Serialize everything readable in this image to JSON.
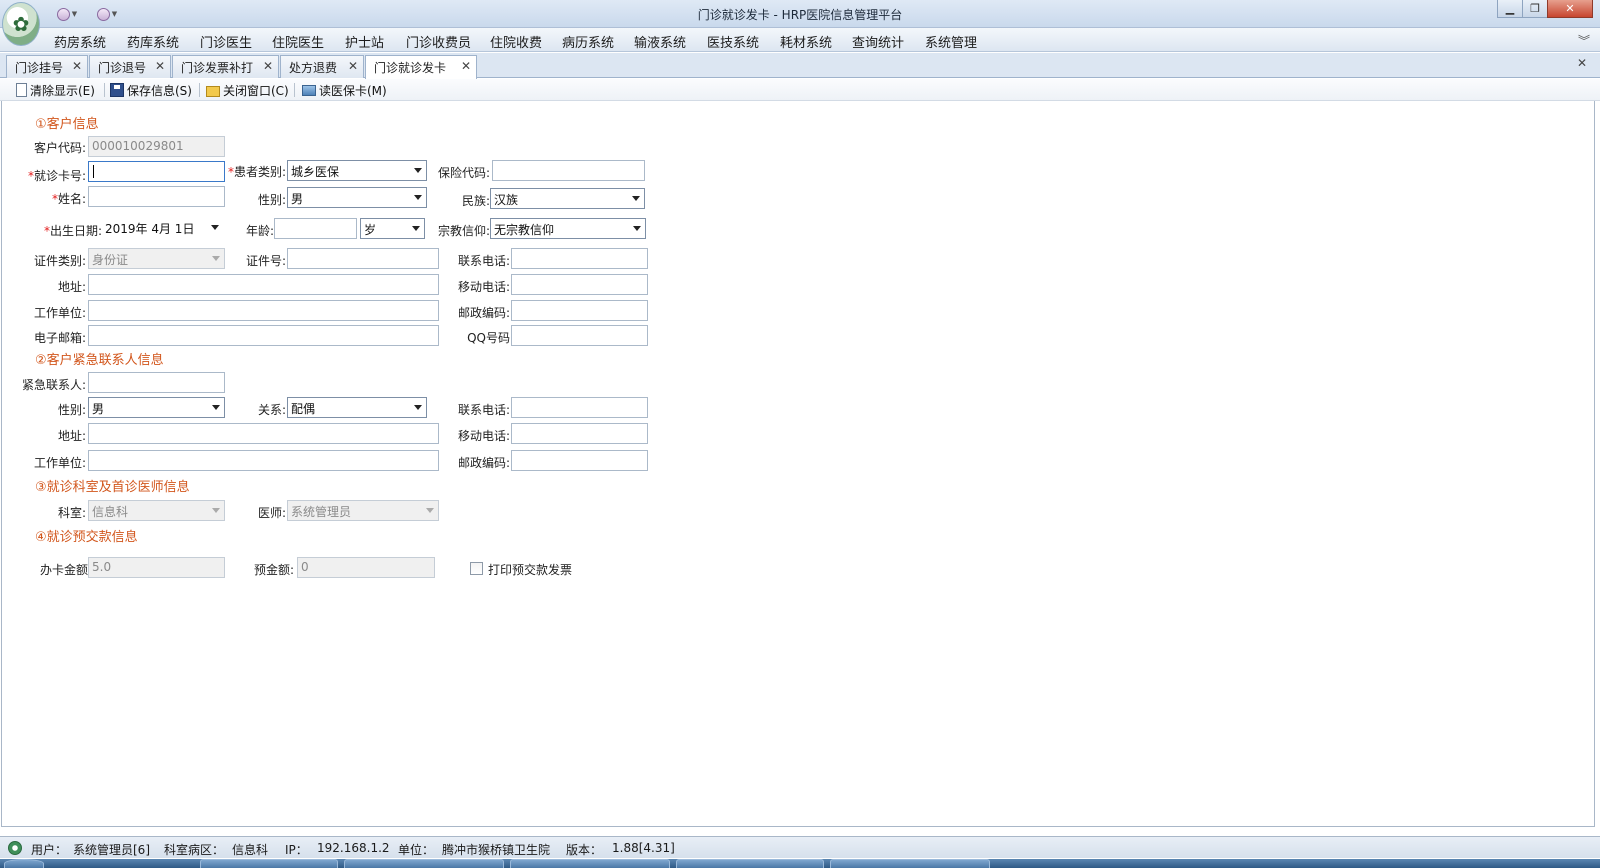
{
  "window": {
    "title": "门诊就诊发卡 - HRP医院信息管理平台",
    "min_glyph": "▁",
    "max_glyph": "❐",
    "close_glyph": "✕"
  },
  "menu": {
    "items": [
      "药房系统",
      "药库系统",
      "门诊医生",
      "住院医生",
      "护士站",
      "门诊收费员",
      "住院收费",
      "病历系统",
      "输液系统",
      "医技系统",
      "耗材系统",
      "查询统计",
      "系统管理"
    ],
    "collapse_glyph": "︾"
  },
  "tabs": {
    "items": [
      {
        "label": "门诊挂号"
      },
      {
        "label": "门诊退号"
      },
      {
        "label": "门诊发票补打"
      },
      {
        "label": "处方退费"
      },
      {
        "label": "门诊就诊发卡"
      }
    ],
    "active_index": 4,
    "close_glyph": "✕"
  },
  "toolbar": {
    "clear_label": "清除显示(E)",
    "save_label": "保存信息(S)",
    "close_label": "关闭窗口(C)",
    "read_card_label": "读医保卡(M)"
  },
  "form": {
    "section1_title": "①客户信息",
    "customer_code_label": "客户代码:",
    "customer_code_value": "000010029801",
    "card_no_label": "就诊卡号:",
    "card_no_value": "",
    "patient_type_label": "患者类别:",
    "patient_type_value": "城乡医保",
    "insurance_code_label": "保险代码:",
    "insurance_code_value": "",
    "name_label": "姓名:",
    "name_value": "",
    "gender_label": "性别:",
    "gender_value": "男",
    "ethnicity_label": "民族:",
    "ethnicity_value": "汉族",
    "birth_label": "出生日期:",
    "birth_value": "2019年  4月  1日",
    "age_label": "年龄:",
    "age_value": "",
    "age_unit_value": "岁",
    "religion_label": "宗教信仰:",
    "religion_value": "无宗教信仰",
    "id_type_label": "证件类别:",
    "id_type_value": "身份证",
    "id_no_label": "证件号:",
    "id_no_value": "",
    "phone_label": "联系电话:",
    "phone_value": "",
    "address_label": "地址:",
    "address_value": "",
    "mobile_label": "移动电话:",
    "mobile_value": "",
    "work_label": "工作单位:",
    "work_value": "",
    "postcode_label": "邮政编码:",
    "postcode_value": "",
    "email_label": "电子邮箱:",
    "email_value": "",
    "qq_label": "QQ号码",
    "qq_value": "",
    "required_mark": "*",
    "section2_title": "②客户紧急联系人信息",
    "ec_name_label": "紧急联系人:",
    "ec_name_value": "",
    "ec_gender_label": "性别:",
    "ec_gender_value": "男",
    "ec_relation_label": "关系:",
    "ec_relation_value": "配偶",
    "ec_phone_label": "联系电话:",
    "ec_phone_value": "",
    "ec_address_label": "地址:",
    "ec_address_value": "",
    "ec_mobile_label": "移动电话:",
    "ec_mobile_value": "",
    "ec_work_label": "工作单位:",
    "ec_work_value": "",
    "ec_postcode_label": "邮政编码:",
    "ec_postcode_value": "",
    "section3_title": "③就诊科室及首诊医师信息",
    "dept_label": "科室:",
    "dept_value": "信息科",
    "doctor_label": "医师:",
    "doctor_value": "系统管理员",
    "section4_title": "④就诊预交款信息",
    "card_fee_label": "办卡金额",
    "card_fee_value": "5.0",
    "prepay_label": "预金额:",
    "prepay_value": "0",
    "print_invoice_label": "打印预交款发票"
  },
  "status": {
    "user_label": "用户：",
    "user_value": "系统管理员[6]",
    "dept_label": "科室病区：",
    "dept_value": "信息科",
    "ip_label": "IP：",
    "ip_value": "192.168.1.2",
    "unit_label": "单位：",
    "unit_value": "腾冲市猴桥镇卫生院",
    "version_label": "版本：",
    "version_value": "1.88[4.31]"
  }
}
